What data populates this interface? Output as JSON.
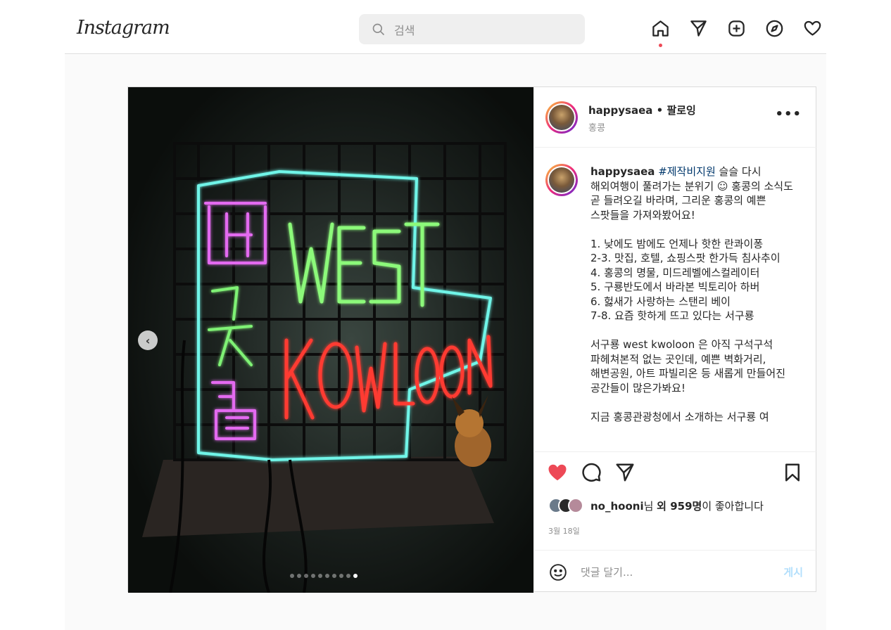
{
  "header": {
    "logo": "Instagram",
    "search_placeholder": "검색"
  },
  "post": {
    "username": "happysaea",
    "follow_status": "팔로잉",
    "location": "홍콩",
    "more_label": "•••",
    "carousel": {
      "total": 10,
      "current_index": 10
    },
    "caption": {
      "username": "happysaea",
      "hashtag": "#제작비지원",
      "text": " 슬슬 다시 해외여행이 풀려가는 분위기 ☺ 홍콩의 소식도 곧 들려오길 바라며, 그리운 홍콩의 예쁜 스팟들을 가져와봤어요!\n\n1. 낮에도 밤에도 언제나 핫한 란콰이퐁\n2-3. 맛집, 호텔, 쇼핑스팟 한가득 침사추이\n4. 홍콩의 명물, 미드레벨에스컬레이터\n5. 구룡반도에서 바라본 빅토리아 하버\n6. 헗새가 사랑하는 스탠리 베이\n7-8. 요즘 핫하게 뜨고 있다는 서구룡\n\n서구룡 west kwoloon 은 아직 구석구석 파헤쳐본적 없는 곳인데, 예쁜 벽화거리, 해변공원, 아트 파빌리온 등 새롭게 만들어진 공간들이 많은가봐요!\n\n지금 홍콩관광청에서 소개하는 서구룡 여"
    },
    "likes": {
      "user": "no_hooni",
      "user_suffix": "님 ",
      "count_text": "외 959명",
      "suffix": "이 좋아합니다"
    },
    "date": "3월 18일",
    "comment_placeholder": "댓글 달기...",
    "post_button": "게시"
  },
  "colors": {
    "like_red": "#ed4956",
    "post_button_disabled": "#b2dffc",
    "hashtag_blue": "#00376b"
  },
  "icons": [
    "search-icon",
    "home-icon",
    "direct-icon",
    "new-post-icon",
    "explore-icon",
    "activity-heart-icon",
    "heart-filled-icon",
    "comment-icon",
    "share-icon",
    "save-icon",
    "emoji-icon",
    "chevron-left-icon"
  ]
}
